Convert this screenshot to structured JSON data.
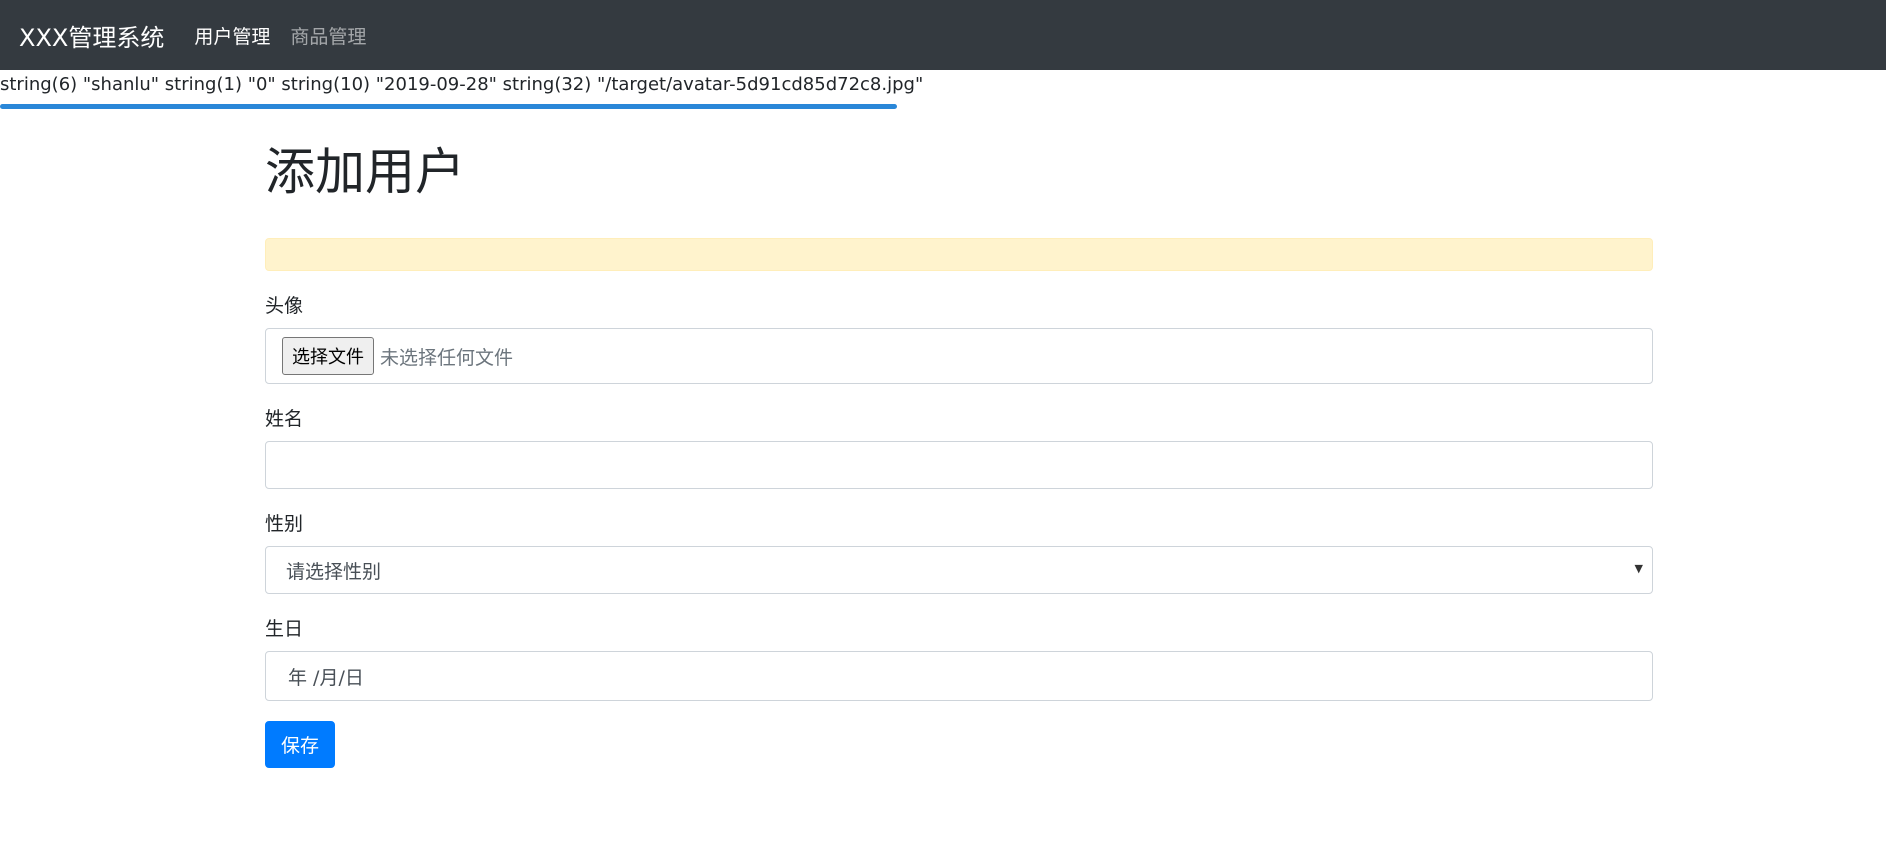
{
  "navbar": {
    "brand": "XXX管理系统",
    "links": [
      {
        "label": "用户管理",
        "active": true
      },
      {
        "label": "商品管理",
        "active": false
      }
    ]
  },
  "debug_output": "string(6) \"shanlu\" string(1) \"0\" string(10) \"2019-09-28\" string(32) \"/target/avatar-5d91cd85d72c8.jpg\"",
  "page": {
    "title": "添加用户",
    "alert_text": ""
  },
  "form": {
    "avatar": {
      "label": "头像",
      "button_label": "选择文件",
      "status": "未选择任何文件"
    },
    "name": {
      "label": "姓名",
      "value": ""
    },
    "gender": {
      "label": "性别",
      "selected": "请选择性别"
    },
    "birthday": {
      "label": "生日",
      "placeholder": "年 /月/日"
    },
    "save_label": "保存"
  },
  "colors": {
    "navbar_bg": "#343a40",
    "primary": "#007bff",
    "alert_bg": "#fff3cd",
    "underline": "#2a87d8"
  }
}
